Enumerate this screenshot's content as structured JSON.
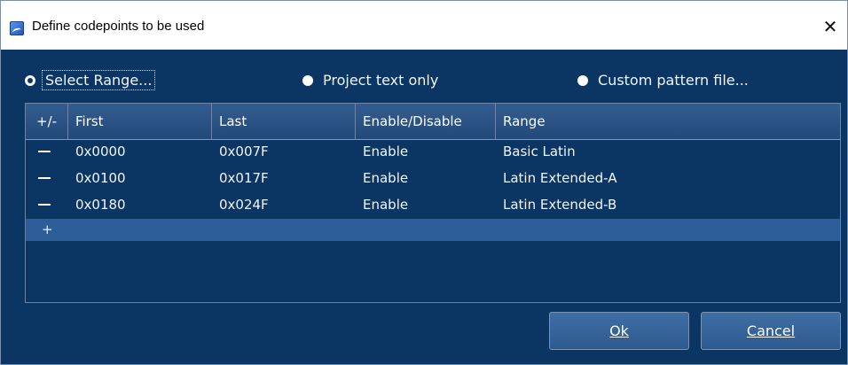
{
  "window": {
    "title": "Define codepoints to be used",
    "close_glyph": "✕"
  },
  "options": {
    "select_range": "Select Range...",
    "project_text_only": "Project text only",
    "custom_pattern_file": "Custom pattern file...",
    "selected": "select_range"
  },
  "table": {
    "headers": {
      "toggle": "+/-",
      "first": "First",
      "last": "Last",
      "enable": "Enable/Disable",
      "range": "Range"
    },
    "rows": [
      {
        "first": "0x0000",
        "last": "0x007F",
        "state": "Enable",
        "range": "Basic Latin"
      },
      {
        "first": "0x0100",
        "last": "0x017F",
        "state": "Enable",
        "range": "Latin Extended-A"
      },
      {
        "first": "0x0180",
        "last": "0x024F",
        "state": "Enable",
        "range": "Latin Extended-B"
      }
    ],
    "add_label": "+"
  },
  "buttons": {
    "ok": "Ok",
    "cancel": "Cancel"
  },
  "colors": {
    "panel": "#0b3563",
    "header": "#2f5789",
    "highlight_row": "#2d5d99",
    "button": "#3a6aa0"
  },
  "icons": {
    "app": "app-icon",
    "close": "close-icon",
    "remove": "minus-icon",
    "add": "plus-icon"
  }
}
